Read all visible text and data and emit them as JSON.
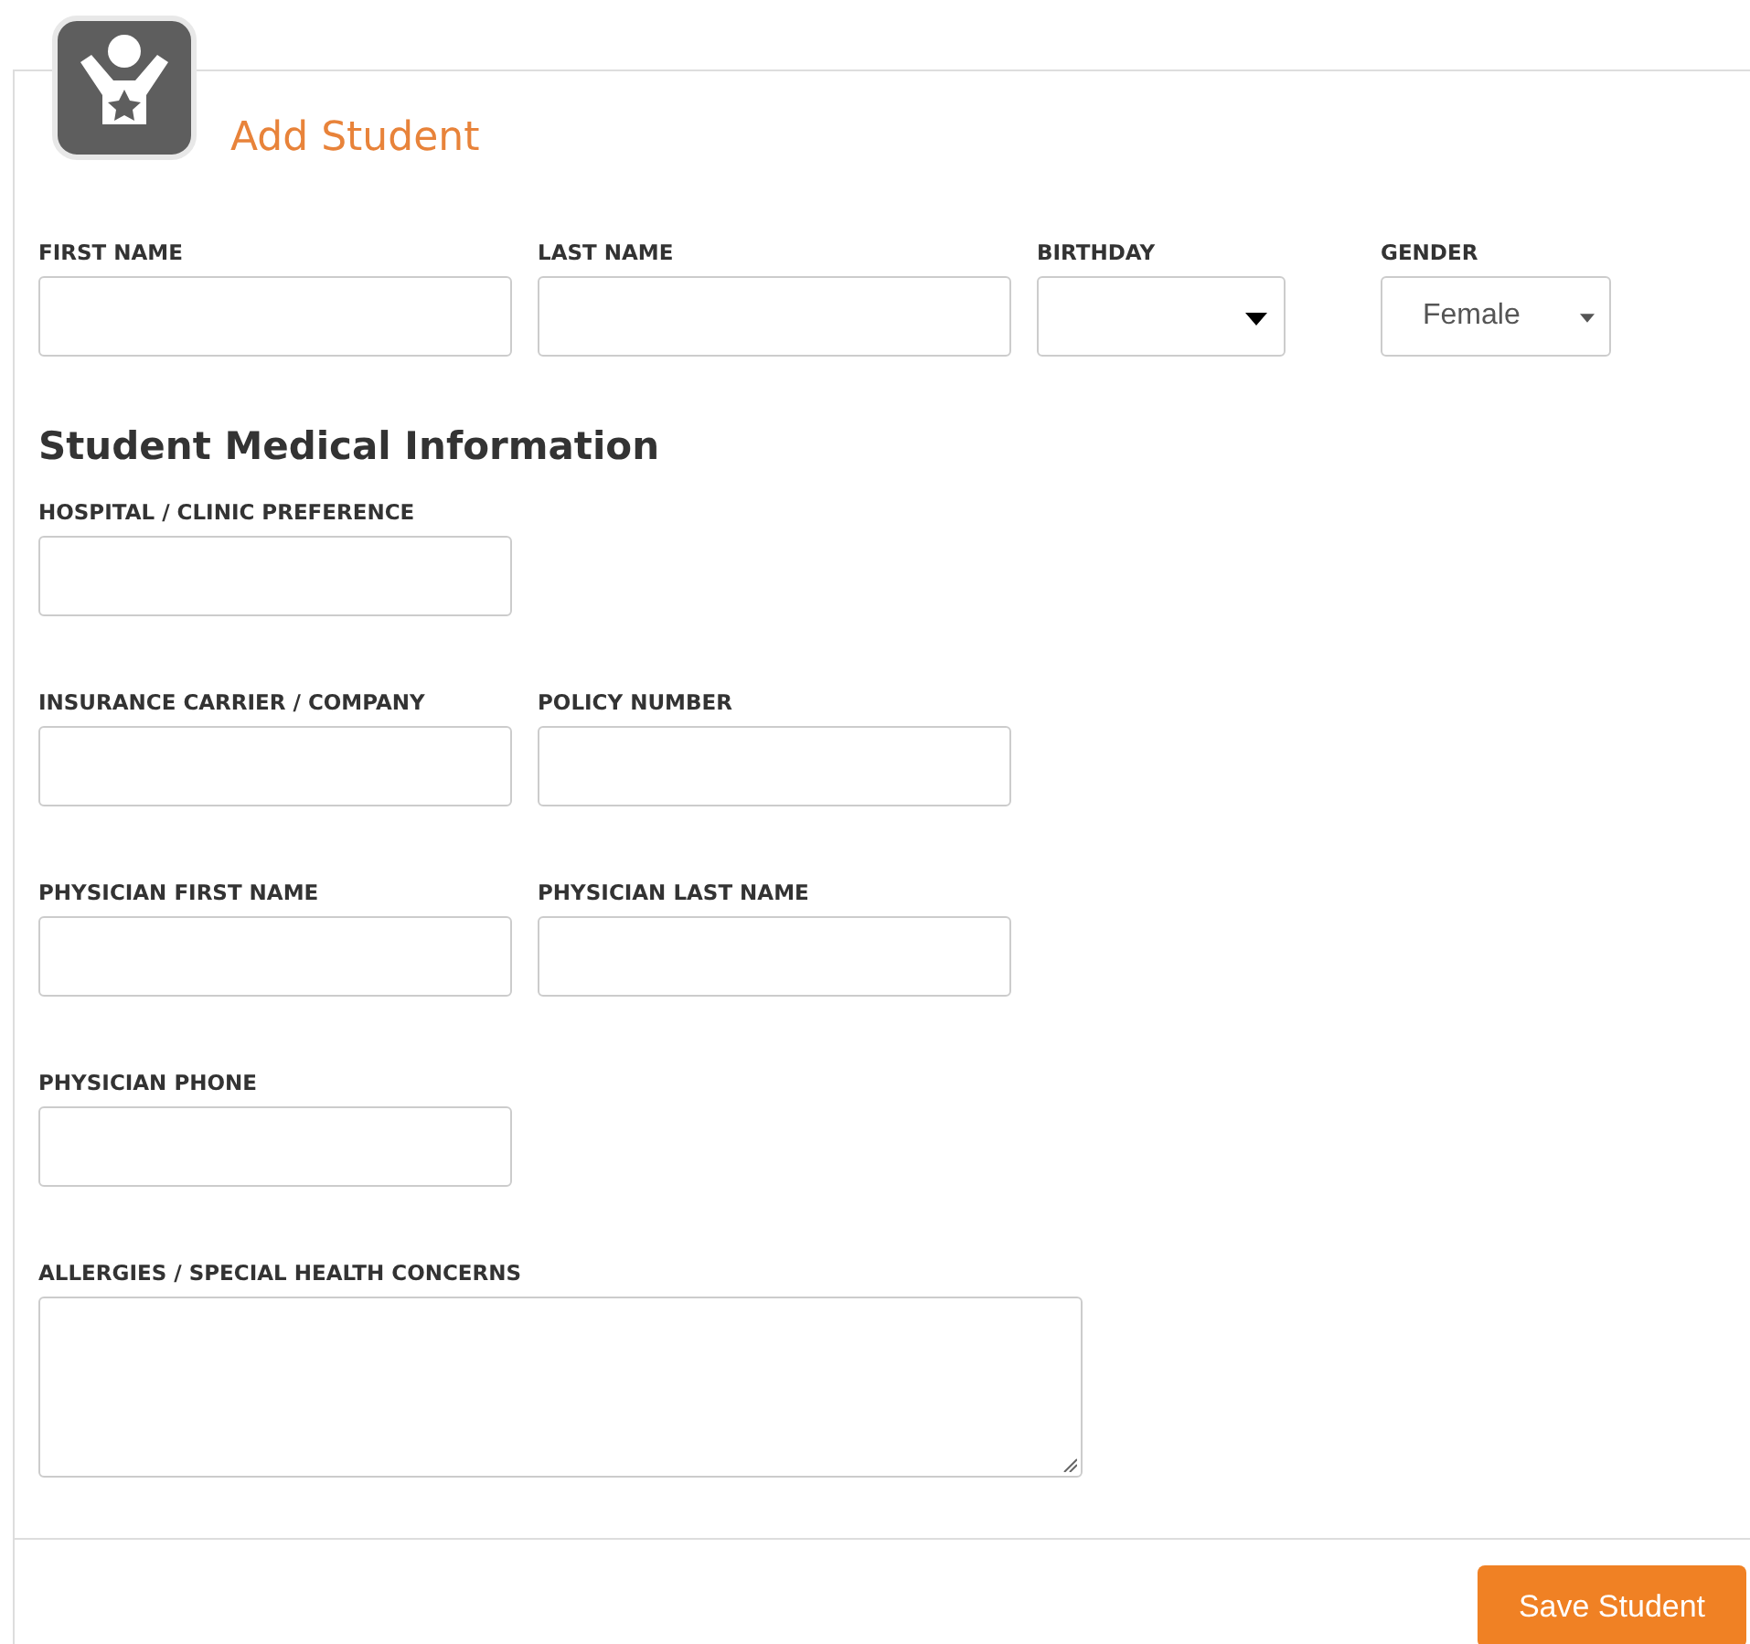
{
  "title": "Add Student",
  "student_rows": [
    [
      {
        "label": "FIRST NAME",
        "kind": "text"
      },
      {
        "label": "LAST NAME",
        "kind": "text"
      },
      {
        "label": "BIRTHDAY",
        "kind": "date"
      },
      {
        "label": "GENDER",
        "kind": "select",
        "value": "Female"
      }
    ]
  ],
  "medical": {
    "heading": "Student Medical Information",
    "rows": [
      [
        {
          "label": "HOSPITAL / CLINIC PREFERENCE",
          "kind": "text"
        }
      ],
      [
        {
          "label": "INSURANCE CARRIER / COMPANY",
          "kind": "text"
        },
        {
          "label": "POLICY NUMBER",
          "kind": "text"
        }
      ],
      [
        {
          "label": "PHYSICIAN FIRST NAME",
          "kind": "text"
        },
        {
          "label": "PHYSICIAN LAST NAME",
          "kind": "text"
        }
      ],
      [
        {
          "label": "PHYSICIAN PHONE",
          "kind": "text"
        }
      ],
      [
        {
          "label": "ALLERGIES / SPECIAL HEALTH CONCERNS",
          "kind": "textarea"
        }
      ]
    ]
  },
  "save_button": "Save Student"
}
